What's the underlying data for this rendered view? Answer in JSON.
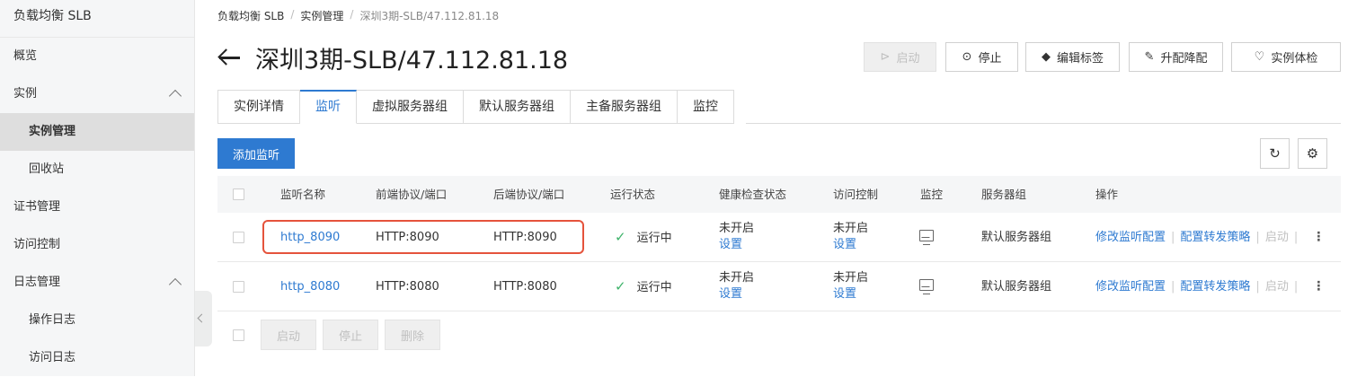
{
  "sidebar": {
    "title": "负载均衡 SLB",
    "items": [
      {
        "label": "概览"
      },
      {
        "label": "实例"
      },
      {
        "label": "实例管理"
      },
      {
        "label": "回收站"
      },
      {
        "label": "证书管理"
      },
      {
        "label": "访问控制"
      },
      {
        "label": "日志管理"
      },
      {
        "label": "操作日志"
      },
      {
        "label": "访问日志"
      }
    ]
  },
  "breadcrumb": {
    "root": "负载均衡 SLB",
    "sep": "/",
    "section": "实例管理",
    "current": "深圳3期-SLB/47.112.81.18"
  },
  "header": {
    "title": "深圳3期-SLB/47.112.81.18",
    "buttons": {
      "start": "启动",
      "stop": "停止",
      "edit_tags": "编辑标签",
      "upgrade": "升配降配",
      "health": "实例体检"
    }
  },
  "tabs": [
    "实例详情",
    "监听",
    "虚拟服务器组",
    "默认服务器组",
    "主备服务器组",
    "监控"
  ],
  "toolbar": {
    "add_listener": "添加监听"
  },
  "table": {
    "columns": [
      "监听名称",
      "前端协议/端口",
      "后端协议/端口",
      "运行状态",
      "健康检查状态",
      "访问控制",
      "监控",
      "服务器组",
      "操作"
    ],
    "rows": [
      {
        "name": "http_8090",
        "frontend": "HTTP:8090",
        "backend": "HTTP:8090",
        "status": "运行中",
        "health": "未开启",
        "health_link": "设置",
        "acl": "未开启",
        "acl_link": "设置",
        "server_group": "默认服务器组",
        "op_edit": "修改监听配置",
        "op_forward": "配置转发策略",
        "op_start": "启动"
      },
      {
        "name": "http_8080",
        "frontend": "HTTP:8080",
        "backend": "HTTP:8080",
        "status": "运行中",
        "health": "未开启",
        "health_link": "设置",
        "acl": "未开启",
        "acl_link": "设置",
        "server_group": "默认服务器组",
        "op_edit": "修改监听配置",
        "op_forward": "配置转发策略",
        "op_start": "启动"
      }
    ]
  },
  "bulk": {
    "start": "启动",
    "stop": "停止",
    "delete": "删除"
  },
  "colors": {
    "accent": "#2e7ad1",
    "highlight": "#e5533c",
    "ok": "#3fb36b"
  }
}
